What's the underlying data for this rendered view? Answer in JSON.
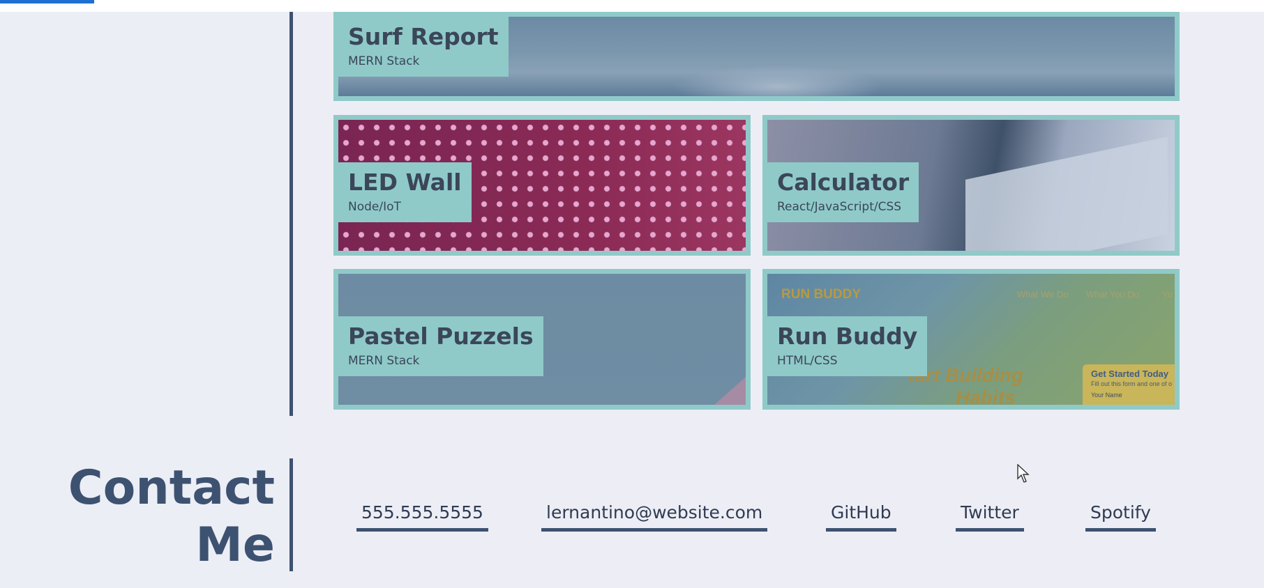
{
  "projects": [
    {
      "title": "Surf Report",
      "subtitle": "MERN Stack"
    },
    {
      "title": "LED Wall",
      "subtitle": "Node/IoT"
    },
    {
      "title": "Calculator",
      "subtitle": "React/JavaScript/CSS"
    },
    {
      "title": "Pastel Puzzels",
      "subtitle": "MERN Stack"
    },
    {
      "title": "Run Buddy",
      "subtitle": "HTML/CSS"
    }
  ],
  "run_buddy_preview": {
    "brand": "RUN BUDDY",
    "nav": [
      "What We Do",
      "What You Do",
      "Yo"
    ],
    "hero_line1": "tart Building",
    "hero_line2": "Habits",
    "form_title": "Get Started Today",
    "form_sub": "Fill out this form and one of o",
    "form_field": "Your Name"
  },
  "contact": {
    "title_line1": "Contact",
    "title_line2": "Me",
    "links": [
      "555.555.5555",
      "lernantino@website.com",
      "GitHub",
      "Twitter",
      "Spotify"
    ]
  },
  "colors": {
    "accent": "#1f6fd1",
    "card_border": "#8fcac9",
    "rule": "#3d5271",
    "text_dark": "#3b4659",
    "background": "#edeef5"
  }
}
